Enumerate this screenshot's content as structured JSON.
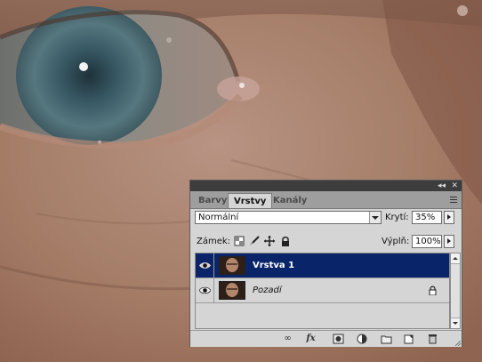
{
  "panel": {
    "tabs": [
      {
        "label": "Barvy",
        "active": false
      },
      {
        "label": "Vrstvy",
        "active": true
      },
      {
        "label": "Kanály",
        "active": false
      }
    ],
    "blend_mode": "Normální",
    "opacity_label": "Krytí:",
    "opacity_value": "35%",
    "lock_label": "Zámek:",
    "fill_label": "Výplň:",
    "fill_value": "100%",
    "layers": [
      {
        "name": "Vrstva 1",
        "selected": true,
        "visible": true,
        "locked": false
      },
      {
        "name": "Pozadí",
        "selected": false,
        "visible": true,
        "locked": true
      }
    ],
    "lock_icons": [
      "lock-transparency-icon",
      "lock-brush-icon",
      "lock-move-icon",
      "lock-all-icon"
    ],
    "bottom_icons": [
      "link-layers-icon",
      "fx-icon",
      "layer-mask-icon",
      "adjustment-layer-icon",
      "new-group-icon",
      "new-layer-icon",
      "delete-layer-icon"
    ]
  },
  "colors": {
    "selected_row": "#0a246a",
    "panel_bg": "#d5d5d5",
    "titlebar": "#3d3d3d",
    "skin_tone": "#a57d67",
    "iris": "#4f6f7a"
  }
}
